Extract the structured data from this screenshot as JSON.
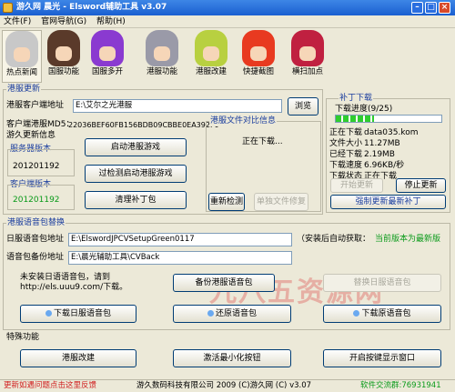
{
  "window": {
    "title": "游久网 晨光 - Elsword辅助工具 v3.07",
    "min": "–",
    "max": "□",
    "close": "×"
  },
  "menu": [
    "文件(F)",
    "官网导航(G)",
    "帮助(H)"
  ],
  "toolbar": [
    {
      "label": "热点新闻",
      "color": "#c8c8c8"
    },
    {
      "label": "国服功能",
      "color": "#5a3a2a"
    },
    {
      "label": "国服多开",
      "color": "#8a3ad0"
    },
    {
      "label": "港服功能",
      "color": "#9a9aa8"
    },
    {
      "label": "港服改建",
      "color": "#b8d040"
    },
    {
      "label": "快捷截图",
      "color": "#e83a20"
    },
    {
      "label": "横扫加点",
      "color": "#c02040"
    }
  ],
  "hk_update": {
    "title": "港服更新",
    "client_path_label": "港服客户端地址",
    "client_path_value": "E:\\艾尔之光港服",
    "browse_button": "浏览",
    "md5_label": "客户端港服MD5：",
    "md5_value": "22036BEF60FB156BDB09CBBE0EA392F0",
    "game_info_label": "游久更新信息",
    "server_version_title": "服务器版本",
    "server_version": "201201192",
    "client_version_title": "客户端版本",
    "client_version": "201201192",
    "start_game_button": "启动港服游戏",
    "skip_check_button": "过检测启动港服游戏",
    "clean_patch_button": "清理补丁包",
    "file_compare_title": "港服文件对比信息",
    "downloading_text": "正在下载...",
    "recheck_button": "重新检测",
    "single_repair_button": "单独文件修复"
  },
  "patch_download": {
    "title": "补丁下载",
    "progress_label": "下载进度(9/25)",
    "progress": 0.36,
    "rows": [
      {
        "label": "正在下载",
        "value": "data035.kom"
      },
      {
        "label": "文件大小",
        "value": "11.27MB"
      },
      {
        "label": "已经下载",
        "value": "2.19MB"
      },
      {
        "label": "下载速度",
        "value": "6.96KB/秒"
      },
      {
        "label": "下载状态",
        "value": "正在下载"
      }
    ],
    "start_button": "开始更新",
    "stop_button": "停止更新",
    "force_button": "强制更新最新补丁"
  },
  "hk_voice": {
    "title": "港服语音包替换",
    "jp_path_label": "日服语音包地址",
    "jp_path_value": "E:\\ElswordJPCVSetupGreen0117",
    "auto_detect": "（安装后自动获取：",
    "latest": "当前版本为最新版",
    "backup_path_label": "语音包备份地址",
    "backup_path_value": "E:\\晨光辅助工具\\CVBack",
    "notice_line1": "未安装日语语音包，请到",
    "notice_line2": "http://els.uuu9.com/下载。",
    "backup_button": "备份港服语音包",
    "replace_button": "替换日服语音包",
    "download_jp_button": "下载日服语音包",
    "restore_button": "还原语音包",
    "download_orig_button": "下载原语音包"
  },
  "special": {
    "title": "特殊功能",
    "hk_modify_button": "港服改建",
    "activate_button": "激活最小化按钮",
    "show_tabs_button": "开启按键显示窗口"
  },
  "watermark": "九八五资源网",
  "statusbar": {
    "left": "更新如遇问题点击这里反馈",
    "center": "游久数码科技有限公司 2009 (C)游久网 (C) v3.07",
    "right": "软件交流群:76931941"
  },
  "colors": {
    "accent": "#1a3d9e",
    "green": "#0a9a1a",
    "red": "#d02020"
  }
}
